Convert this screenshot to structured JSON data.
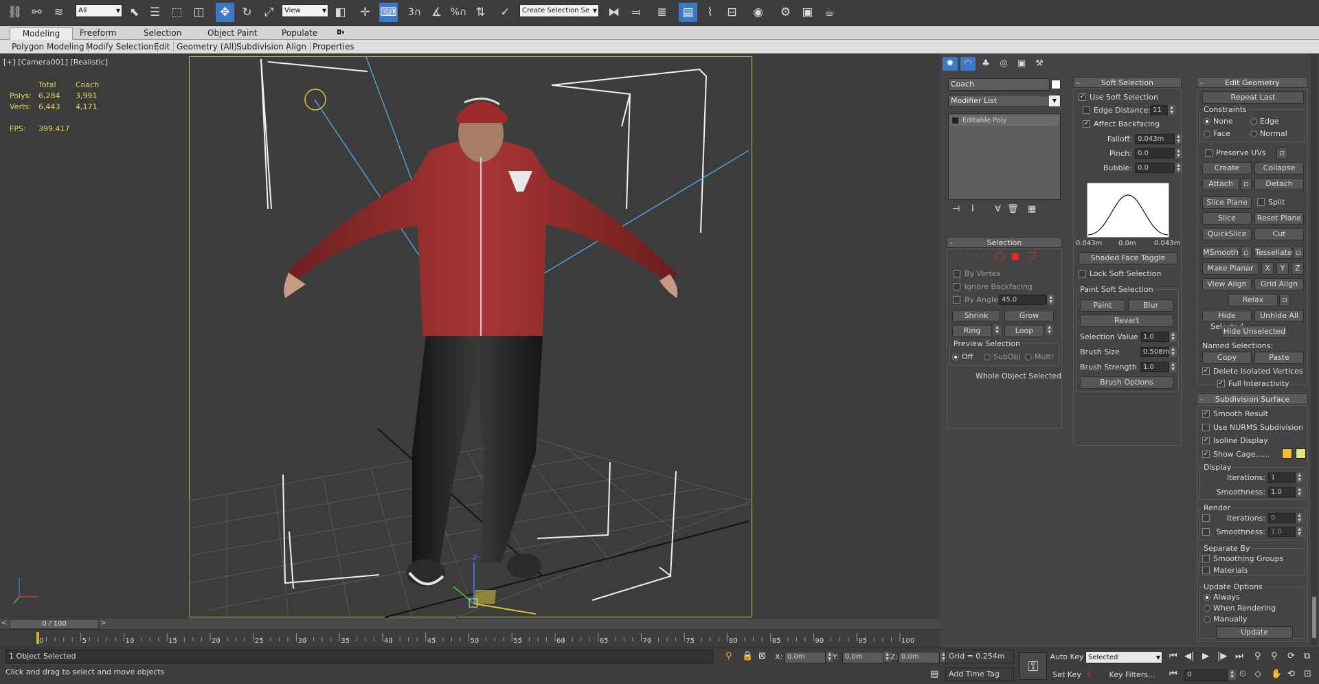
{
  "toolbar": {
    "filter_select": "All",
    "ref_coord_select": "View",
    "named_sel_select": "Create Selection Se",
    "icons": [
      "link-icon",
      "unlink-icon",
      "bind-space-warp-icon",
      "select-icon",
      "select-by-name-icon",
      "rect-selection-icon",
      "window-crossing-icon",
      "move-icon",
      "rotate-icon",
      "scale-icon",
      "pivot-icon",
      "snap-3d-icon",
      "angle-snap-icon",
      "percent-snap-icon",
      "spinner-snap-icon",
      "edit-named-sel-icon",
      "mirror-icon",
      "align-icon",
      "layer-explorer-icon",
      "scene-explorer-icon",
      "curve-editor-icon",
      "schematic-view-icon",
      "material-editor-icon",
      "render-setup-icon",
      "rendered-frame-icon",
      "render-icon"
    ]
  },
  "ribbon": {
    "tabs": [
      "Modeling",
      "Freeform",
      "Selection",
      "Object Paint",
      "Populate"
    ],
    "active_tab": "Modeling",
    "sub_items": [
      "Polygon Modeling",
      "Modify Selection",
      "Edit",
      "Geometry (All)",
      "Subdivision",
      "Align",
      "Properties"
    ]
  },
  "viewport": {
    "label": "[+] [Camera001] [Realistic]",
    "stats": {
      "header_total": "Total",
      "header_obj": "Coach",
      "polys_label": "Polys:",
      "polys_total": "6,284",
      "polys_obj": "3,991",
      "verts_label": "Verts:",
      "verts_total": "6,443",
      "verts_obj": "4,171",
      "fps_label": "FPS:",
      "fps_value": "399.417"
    }
  },
  "modify": {
    "object_name": "Coach",
    "modifier_list": "Modifier List",
    "stack_item": "Editable Poly",
    "selection": {
      "title": "Selection",
      "by_vertex": "By Vertex",
      "ignore_backfacing": "Ignore Backfacing",
      "by_angle": "By Angle:",
      "angle_value": "45.0",
      "shrink": "Shrink",
      "grow": "Grow",
      "ring": "Ring",
      "loop": "Loop",
      "preview_title": "Preview Selection",
      "off": "Off",
      "subobj": "SubObj",
      "multi": "Multi",
      "status": "Whole Object Selected"
    }
  },
  "soft_selection": {
    "title": "Soft Selection",
    "use_soft": "Use Soft Selection",
    "edge_distance": "Edge Distance:",
    "edge_distance_value": "11",
    "affect_backfacing": "Affect Backfacing",
    "falloff": "Falloff:",
    "falloff_value": "0.043m",
    "pinch": "Pinch:",
    "pinch_value": "0.0",
    "bubble": "Bubble:",
    "bubble_value": "0.0",
    "curve_left": "0.043m",
    "curve_mid": "0.0m",
    "curve_right": "0.043m",
    "shaded_toggle": "Shaded Face Toggle",
    "lock_soft": "Lock Soft Selection",
    "paint_title": "Paint Soft Selection",
    "paint": "Paint",
    "blur": "Blur",
    "revert": "Revert",
    "sel_value": "Selection Value",
    "sel_value_v": "1.0",
    "brush_size": "Brush Size",
    "brush_size_v": "0.508m",
    "brush_strength": "Brush Strength",
    "brush_strength_v": "1.0",
    "brush_options": "Brush Options"
  },
  "edit_geometry": {
    "title": "Edit Geometry",
    "repeat_last": "Repeat Last",
    "constraints": "Constraints",
    "none": "None",
    "edge": "Edge",
    "face": "Face",
    "normal": "Normal",
    "preserve_uvs": "Preserve UVs",
    "create": "Create",
    "collapse": "Collapse",
    "attach": "Attach",
    "detach": "Detach",
    "slice_plane": "Slice Plane",
    "split": "Split",
    "slice": "Slice",
    "reset_plane": "Reset Plane",
    "quickslice": "QuickSlice",
    "cut": "Cut",
    "msmooth": "MSmooth",
    "tessellate": "Tessellate",
    "make_planar": "Make Planar",
    "x": "X",
    "y": "Y",
    "z": "Z",
    "view_align": "View Align",
    "grid_align": "Grid Align",
    "relax": "Relax",
    "hide_selected": "Hide Selected",
    "unhide_all": "Unhide All",
    "hide_unselected": "Hide Unselected",
    "named_selections": "Named Selections:",
    "copy": "Copy",
    "paste": "Paste",
    "delete_isolated": "Delete Isolated Vertices",
    "full_interactivity": "Full Interactivity"
  },
  "subdivision": {
    "title": "Subdivision Surface",
    "smooth_result": "Smooth Result",
    "use_nurms": "Use NURMS Subdivision",
    "isoline": "Isoline Display",
    "show_cage": "Show Cage......",
    "display": "Display",
    "iterations": "Iterations:",
    "iter_display": "1",
    "smoothness": "Smoothness:",
    "smooth_display": "1.0",
    "render": "Render",
    "iter_render": "0",
    "smooth_render": "1.0",
    "separate_by": "Separate By",
    "smoothing_groups": "Smoothing Groups",
    "materials": "Materials",
    "update_options": "Update Options",
    "always": "Always",
    "when_rendering": "When Rendering",
    "manually": "Manually",
    "update": "Update",
    "cage_color1": "#f2c12e",
    "cage_color2": "#e8e07a"
  },
  "timeline": {
    "frame_display": "0 / 100",
    "ticks": [
      "0",
      "5",
      "10",
      "15",
      "20",
      "25",
      "30",
      "35",
      "40",
      "45",
      "50",
      "55",
      "60",
      "65",
      "70",
      "75",
      "80",
      "85",
      "90",
      "95",
      "100"
    ]
  },
  "status": {
    "objects_selected": "1 Object Selected",
    "prompt": "Click and drag to select and move objects",
    "x_label": "X:",
    "x_value": "0.0m",
    "y_label": "Y:",
    "y_value": "0.0m",
    "z_label": "Z:",
    "z_value": "0.0m",
    "grid": "Grid = 0.254m",
    "add_time_tag": "Add Time Tag",
    "auto_key": "Auto Key",
    "set_key": "Set Key",
    "selected_dropdown": "Selected",
    "key_filters": "Key Filters...",
    "frame_field": "0"
  }
}
